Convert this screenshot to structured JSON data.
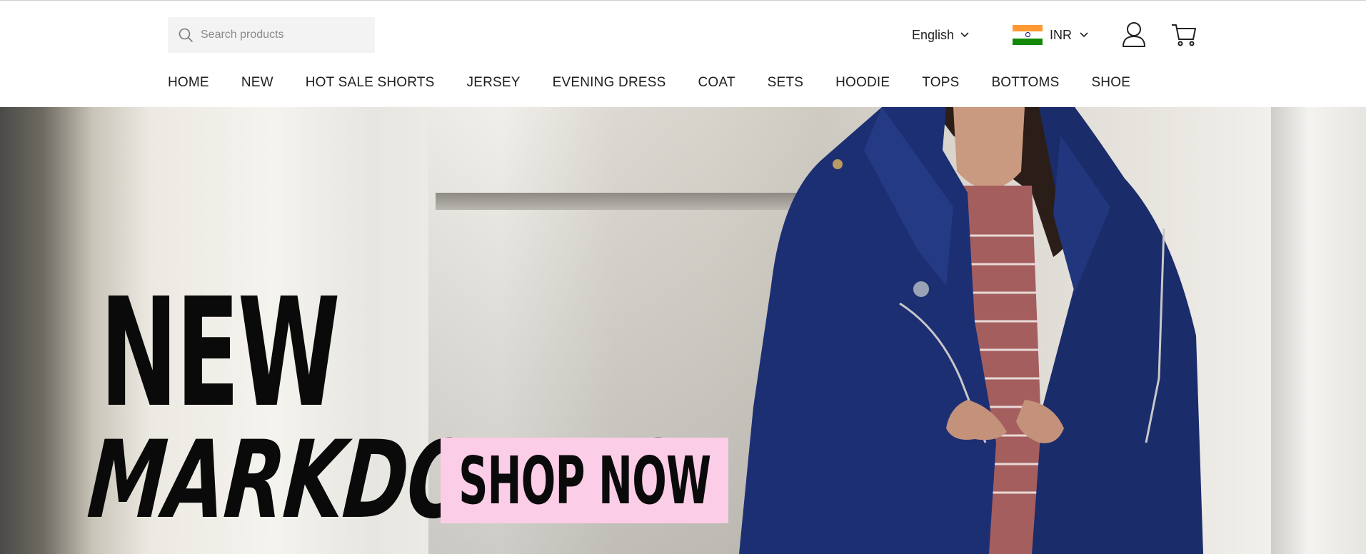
{
  "header": {
    "search": {
      "placeholder": "Search products",
      "icon": "search-icon"
    },
    "language": {
      "label": "English",
      "icon": "chevron-down-icon"
    },
    "currency": {
      "label": "INR",
      "flag": "india-flag-icon",
      "icon": "chevron-down-icon"
    },
    "account": {
      "icon": "user-icon"
    },
    "cart": {
      "icon": "cart-icon"
    }
  },
  "nav": {
    "items": [
      "HOME",
      "NEW",
      "HOT SALE SHORTS",
      "JERSEY",
      "EVENING DRESS",
      "COAT",
      "SETS",
      "HOODIE",
      "TOPS",
      "BOTTOMS",
      "SHOE"
    ]
  },
  "hero": {
    "headline_line1": "NEW",
    "headline_line2": "MARKDOWNS",
    "cta_label": "SHOP NOW",
    "cta_color": "#fccde7"
  },
  "colors": {
    "text": "#1e1e1e",
    "search_bg": "#f3f3f3",
    "jacket": "#1d2f73"
  }
}
